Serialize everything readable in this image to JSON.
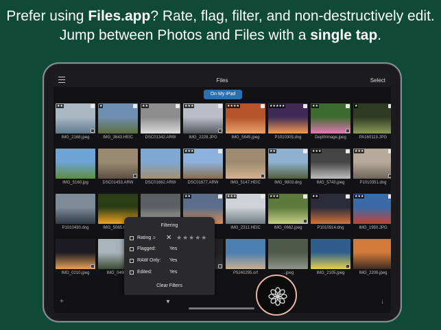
{
  "headline": {
    "t1": "Prefer using ",
    "b1": "Files.app",
    "t2": "? Rate, flag, filter, and non-destructively edit. Jump between Photos and Files with a ",
    "b2": "single tap",
    "t3": "."
  },
  "navbar": {
    "title": "Files",
    "select": "Select"
  },
  "location_pill": "On My iPad",
  "grid": [
    {
      "name": "IMG_2168.jpeg",
      "stars": "★★",
      "colors": [
        "#aab8c4",
        "#5f7a8e"
      ]
    },
    {
      "name": "IMG_3643.HEIC",
      "stars": "★",
      "colors": [
        "#6f8fb2",
        "#5d6d3f"
      ]
    },
    {
      "name": "DSC01342.ARW",
      "stars": "★★",
      "colors": [
        "#8d8d8d",
        "#dcdcdc"
      ]
    },
    {
      "name": "IMG_2228.JPG",
      "stars": "★★★",
      "colors": [
        "#b9bec7",
        "#555a60"
      ]
    },
    {
      "name": "IMG_5645.jpeg",
      "stars": "★★★★",
      "colors": [
        "#b6532b",
        "#e6a46b"
      ]
    },
    {
      "name": "P1010305.dng",
      "stars": "★★★★★",
      "colors": [
        "#3f2a55",
        "#f19a52"
      ]
    },
    {
      "name": "DepthImage.jpeg",
      "stars": "★★",
      "colors": [
        "#3c6b2f",
        "#e57ab6"
      ]
    },
    {
      "name": "PA160113.JPG",
      "stars": "★",
      "colors": [
        "#2e3a22",
        "#8a9a58"
      ]
    },
    {
      "name": "IMG_5160.jpg",
      "stars": "",
      "colors": [
        "#6ea3d6",
        "#5d8e3c"
      ]
    },
    {
      "name": "DSC01453.ARW",
      "stars": "",
      "colors": [
        "#9b8a72",
        "#5a4f41"
      ]
    },
    {
      "name": "DSC01662.ARW",
      "stars": "",
      "colors": [
        "#7ea7d4",
        "#a58e6b"
      ]
    },
    {
      "name": "DSC01677.ARW",
      "stars": "★★★",
      "colors": [
        "#8cb2dc",
        "#8a6d4a"
      ]
    },
    {
      "name": "IMG_5147.HEIC",
      "stars": "",
      "colors": [
        "#9d8a70",
        "#d7b28e"
      ]
    },
    {
      "name": "IMG_9803.dng",
      "stars": "★★",
      "colors": [
        "#8fb0cf",
        "#4f5e3a"
      ]
    },
    {
      "name": "IMG_5743.jpeg",
      "stars": "★★★",
      "colors": [
        "#444444",
        "#bdbdbd"
      ]
    },
    {
      "name": "P1010351.dng",
      "stars": "★★★",
      "colors": [
        "#b7aa9a",
        "#6e645a"
      ]
    },
    {
      "name": "P1010430.dng",
      "stars": "",
      "colors": [
        "#7d8a98",
        "#2f3a44"
      ]
    },
    {
      "name": "IMG_5065.HEIC",
      "stars": "",
      "colors": [
        "#2c3d16",
        "#f2a21c"
      ]
    },
    {
      "name": "",
      "stars": "",
      "colors": [
        "#5a5f63",
        "#bdb8ae"
      ]
    },
    {
      "name": "",
      "stars": "★★",
      "colors": [
        "#5a6e8c",
        "#d98e5a"
      ]
    },
    {
      "name": "IMG_2311.HEIC",
      "stars": "★★★",
      "colors": [
        "#cdd3d8",
        "#6f7a80"
      ]
    },
    {
      "name": "IMG_0662.jpeg",
      "stars": "★★★",
      "colors": [
        "#5d7a3c",
        "#c6d08a"
      ]
    },
    {
      "name": "P1010914.dng",
      "stars": "★★",
      "colors": [
        "#2b2b3a",
        "#d6733a"
      ]
    },
    {
      "name": "IMG_1950.JPG",
      "stars": "★★★",
      "colors": [
        "#3a6aa8",
        "#c24338"
      ]
    },
    {
      "name": "IMG_0210.jpeg",
      "stars": "",
      "colors": [
        "#1c1c22",
        "#e8a05a"
      ]
    },
    {
      "name": "IMG_0496...",
      "stars": "",
      "colors": [
        "#a9b3bc",
        "#3f4c34"
      ]
    },
    {
      "name": "",
      "stars": "",
      "colors": [
        "#222",
        "#333"
      ]
    },
    {
      "name": "",
      "stars": "",
      "colors": [
        "#222",
        "#333"
      ]
    },
    {
      "name": "P5240295.orf",
      "stars": "",
      "colors": [
        "#4a7fb0",
        "#c6b08e"
      ]
    },
    {
      "name": "...jpeg",
      "stars": "",
      "colors": [
        "#4f5a4c",
        "#8e948a"
      ]
    },
    {
      "name": "IMG_2105.jpeg",
      "stars": "",
      "colors": [
        "#2e5f8c",
        "#e7d04a"
      ]
    },
    {
      "name": "IMG_2206.jpeg",
      "stars": "",
      "colors": [
        "#d27a3a",
        "#3b2a22"
      ]
    }
  ],
  "filter_popover": {
    "title": "Filtering",
    "rating_label": "Rating",
    "rating_op": "≥",
    "rating_clear": "✕",
    "rating_stars": "★★★★★",
    "flagged_label": "Flagged:",
    "flagged_value": "Yes",
    "raw_label": "RAW Only:",
    "raw_value": "Yes",
    "edited_label": "Edited:",
    "edited_value": "Yes",
    "clear_label": "Clear Filters"
  },
  "toolbar": {
    "plus": "+",
    "filter": "▼",
    "down": "↓"
  },
  "accent_color": "#2a6fb0",
  "background_color": "#0f4a36"
}
